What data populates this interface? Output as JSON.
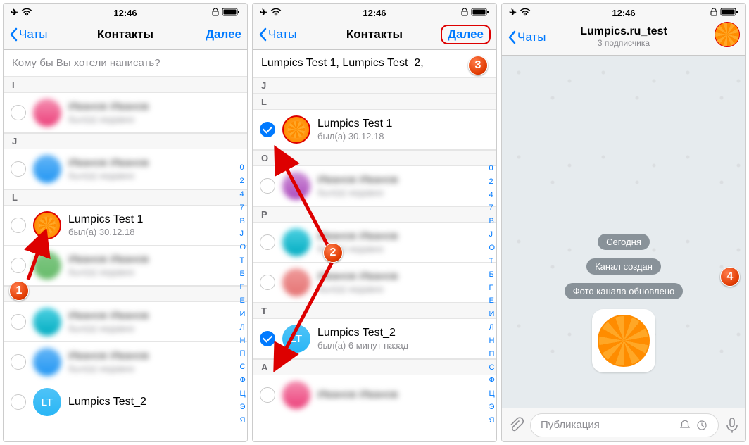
{
  "status": {
    "time": "12:46"
  },
  "nav": {
    "back": "Чаты",
    "title_contacts": "Контакты",
    "next": "Далее",
    "channel_title": "Lumpics.ru_test",
    "channel_sub": "3 подписчика"
  },
  "search_placeholder": "Кому бы Вы хотели написать?",
  "selected_names": "Lumpics Test 1,  Lumpics Test_2,",
  "index_letters": [
    "0",
    "2",
    "4",
    "7",
    "В",
    "J",
    "О",
    "Т",
    "Б",
    "Г",
    "Е",
    "И",
    "Л",
    "Н",
    "П",
    "С",
    "Ф",
    "Ц",
    "Э",
    "Я"
  ],
  "index_letters2": [
    "0",
    "2",
    "4",
    "7",
    "В",
    "J",
    "О",
    "Т",
    "Б",
    "Г",
    "Е",
    "И",
    "Л",
    "Н",
    "П",
    "С",
    "Ф",
    "Ц",
    "Э",
    "Я"
  ],
  "p1": {
    "sections": [
      {
        "letter": "I",
        "rows": [
          {
            "name": "blurred",
            "sub": "blurred",
            "av": "av-pink"
          }
        ]
      },
      {
        "letter": "J",
        "rows": [
          {
            "name": "blurred",
            "sub": "blurred",
            "av": "av-blue"
          }
        ]
      },
      {
        "letter": "L",
        "rows": [
          {
            "name": "Lumpics Test 1",
            "sub": "был(а) 30.12.18",
            "orange": true
          },
          {
            "name": "blurred",
            "sub": "blurred",
            "av": "av-green"
          }
        ]
      },
      {
        "letter": "P",
        "rows": [
          {
            "name": "blurred",
            "sub": "blurred",
            "av": "av-teal"
          },
          {
            "name": "blurred",
            "sub": "blurred",
            "av": "av-blue"
          }
        ]
      },
      {
        "letter": "",
        "rows": [
          {
            "name": "Lumpics Test_2",
            "sub": "",
            "lt": true
          }
        ]
      }
    ]
  },
  "p2": {
    "sections": [
      {
        "letter": "J",
        "rows": []
      },
      {
        "letter": "L",
        "rows": [
          {
            "name": "Lumpics Test 1",
            "sub": "был(а) 30.12.18",
            "orange": true,
            "checked": true
          }
        ]
      },
      {
        "letter": "O",
        "rows": [
          {
            "name": "blurred",
            "sub": "blurred",
            "av": "av-purple"
          }
        ]
      },
      {
        "letter": "P",
        "rows": [
          {
            "name": "blurred",
            "sub": "blurred",
            "av": "av-teal"
          },
          {
            "name": "blurred",
            "sub": "blurred",
            "av": "av-red"
          }
        ]
      },
      {
        "letter": "T",
        "rows": [
          {
            "name": "Lumpics Test_2",
            "sub": "был(а) 6 минут назад",
            "lt": true,
            "checked": true,
            "lt_label": "LT"
          }
        ]
      },
      {
        "letter": "A",
        "rows": [
          {
            "name": "blurred",
            "sub": "",
            "av": "av-pink"
          }
        ]
      }
    ]
  },
  "chat": {
    "chips": [
      "Сегодня",
      "Канал создан",
      "Фото канала обновлено"
    ],
    "compose_placeholder": "Публикация"
  }
}
